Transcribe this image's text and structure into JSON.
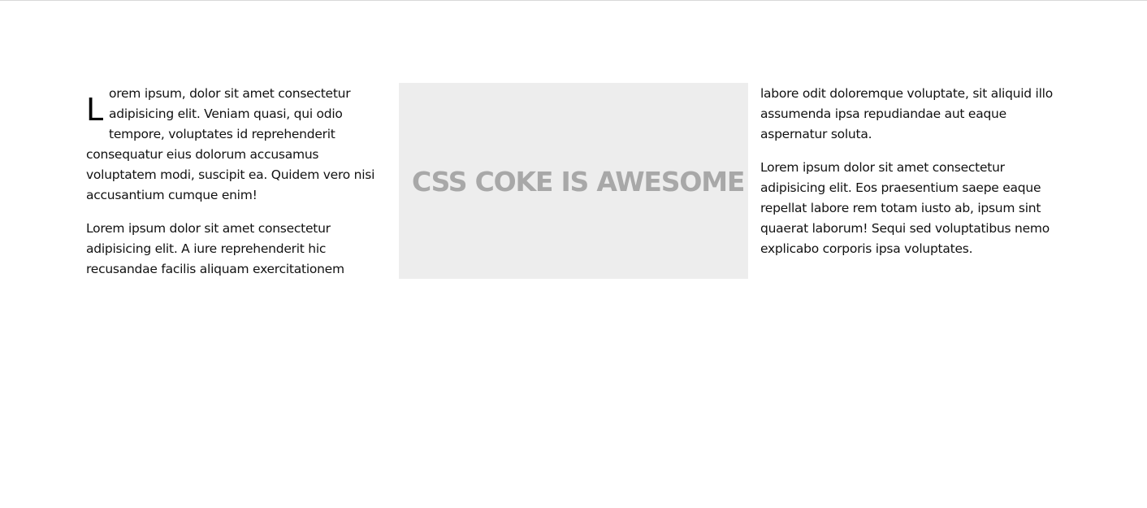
{
  "left_column": {
    "dropcap": "L",
    "paragraph1_lines": [
      "orem ipsum, dolor sit amet consectetur",
      "adipisicing elit. Veniam quasi, qui odio",
      "tempore, voluptates id reprehenderit",
      "consequatur eius dolorum accusamus",
      "voluptatem modi, suscipit ea. Quidem vero nisi",
      "accusantium cumque enim!"
    ],
    "paragraph2_lines": [
      "Lorem ipsum dolor sit amet consectetur",
      "adipisicing elit. A iure reprehenderit hic",
      "recusandae facilis aliquam exercitationem"
    ]
  },
  "feature": {
    "text": "CSS COKE IS AWESOME",
    "background_color": "#ededed",
    "text_color": "#a8a8a8"
  },
  "right_column": {
    "paragraph1_lines": [
      "labore odit doloremque voluptate, sit aliquid illo",
      "assumenda ipsa repudiandae aut eaque",
      "aspernatur soluta."
    ],
    "paragraph2_lines": [
      "Lorem ipsum dolor sit amet consectetur",
      "adipisicing elit. Eos praesentium saepe eaque",
      "repellat labore rem totam iusto ab, ipsum sint",
      "quaerat laborum! Sequi sed voluptatibus nemo",
      "explicabo corporis ipsa voluptates."
    ]
  }
}
